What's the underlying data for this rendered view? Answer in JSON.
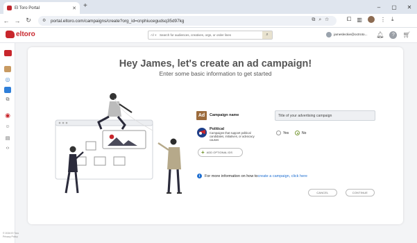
{
  "browser": {
    "tab_title": "El Toro Portal",
    "url": "portal.eltoro.com/campaigns/create?org_id=cnphiucegudsq35d97kg"
  },
  "header": {
    "logo": "eltoro",
    "search_scope": "All",
    "search_placeholder": "Search for audiences, creatives, orgs, or order lines",
    "user_email": "jamesleckie@octroto..."
  },
  "footer": {
    "line1": "© 2024 El Toro",
    "line2": "Privacy Policy"
  },
  "main": {
    "title": "Hey James, let's create an ad campaign!",
    "subtitle": "Enter some basic information to get started",
    "ad_icon_label": "Ad",
    "campaign_name_label": "Campaign name",
    "campaign_name_value": "Title of your advertising campaign",
    "political_label": "Political",
    "political_desc": "Campaigns that support political candidates, initiatives, or advocacy causes",
    "radio_yes": "Yes",
    "radio_no": "No",
    "radio_selected": "No",
    "add_optional_button": "ADD OPTIONAL IDS",
    "info_text": "For more information on how to ",
    "info_link": "create a campaign, click here",
    "cancel_button": "CANCEL",
    "continue_button": "CONTINUE"
  },
  "colors": {
    "brand": "#c8262c",
    "accent_green": "#7a9a3a",
    "link_blue": "#1f6fd1"
  }
}
